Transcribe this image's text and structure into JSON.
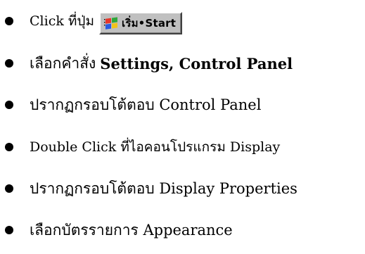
{
  "steps": [
    {
      "text": "Click ที่ปุ่ม",
      "start_button": {
        "label": "เริ่ม•Start",
        "icon": "windows-flag-icon"
      }
    },
    {
      "prefix": "เลือกคำสั่ง",
      "bold": "Settings, Control Panel"
    },
    {
      "text": "ปรากฏกรอบโต้ตอบ Control Panel"
    },
    {
      "text": "Double Click ที่ไอคอนโปรแกรม Display"
    },
    {
      "text": "ปรากฏกรอบโต้ตอบ Display Properties"
    },
    {
      "text": "เลือกบัตรรายการ Appearance"
    }
  ],
  "colors": {
    "text": "#000000",
    "bullet": "#000000",
    "button_face": "#c0c0c0",
    "flag_red": "#e8362a",
    "flag_green": "#2fa83b",
    "flag_blue": "#2a5be0",
    "flag_yellow": "#f2c31b"
  }
}
